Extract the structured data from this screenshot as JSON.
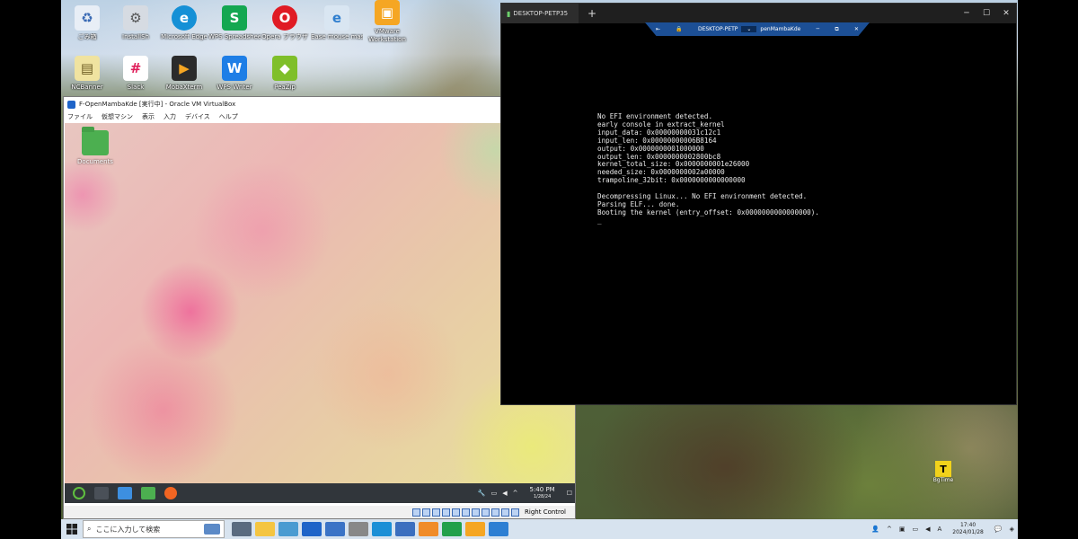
{
  "desktop": {
    "icons": [
      {
        "label": "ごみ箱",
        "icon": "recycle-bin-icon",
        "color": "#e8eef6"
      },
      {
        "label": "InstallSh",
        "icon": "installer-icon",
        "color": "#d6dbe2"
      },
      {
        "label": "Microsoft Edge",
        "icon": "edge-icon",
        "color": "#1590d6"
      },
      {
        "label": "WPS Spreadsheets",
        "icon": "wps-spreadsheets-icon",
        "color": "#14a751"
      },
      {
        "label": "Opera ブラウザ",
        "icon": "opera-icon",
        "color": "#e01b24"
      },
      {
        "label": "Ease mouse master",
        "icon": "document-icon",
        "color": "#d9e6f2"
      },
      {
        "label": "VMware Workstation",
        "icon": "vmware-icon",
        "color": "#f5a623"
      },
      {
        "label": "NCBanner",
        "icon": "notebook-icon",
        "color": "#f0e3a0"
      },
      {
        "label": "Slack",
        "icon": "slack-icon",
        "color": "#ffffff"
      },
      {
        "label": "MobaXterm",
        "icon": "mobaxterm-icon",
        "color": "#2b2b2b"
      },
      {
        "label": "WPS Writer",
        "icon": "wps-writer-icon",
        "color": "#1e7ee6"
      },
      {
        "label": "PeaZip",
        "icon": "peazip-icon",
        "color": "#7fbf2a"
      }
    ],
    "right_icon_label": "BgTime"
  },
  "vbox": {
    "title": "F-OpenMambaKde [実行中] - Oracle VM VirtualBox",
    "menu": [
      "ファイル",
      "仮想マシン",
      "表示",
      "入力",
      "デバイス",
      "ヘルプ"
    ],
    "guest": {
      "desktop_icon_label": "Documents",
      "clock_time": "5:40 PM",
      "clock_date": "1/28/24"
    },
    "status_right": "Right Control"
  },
  "rdp": {
    "tab_title": "DESKTOP-PETP35",
    "connection_bar_left": "DESKTOP-PETP",
    "connection_bar_right": "penMambaKde",
    "console_lines": [
      "No EFI environment detected.",
      "early console in extract_kernel",
      "input_data: 0x00000000031c12c1",
      "input_len: 0x00000000006B8164",
      "output: 0x0000000001000000",
      "output_len: 0x0000000002800bc8",
      "kernel_total_size: 0x0000000001e26000",
      "needed_size: 0x0000000002a00000",
      "trampoline_32bit: 0x0000000000000000",
      "",
      "Decompressing Linux... No EFI environment detected.",
      "Parsing ELF... done.",
      "Booting the kernel (entry_offset: 0x0000000000000000).",
      "_"
    ]
  },
  "taskbar": {
    "search_placeholder": "ここに入力して検索",
    "clock_time": "17:40",
    "clock_date": "2024/01/28",
    "pinned_colors": [
      "#5a6b7f",
      "#f4c542",
      "#4a9bd1",
      "#1e64c8",
      "#3a73c6",
      "#888888",
      "#1b8fd6",
      "#3b6fbf",
      "#f08c2a",
      "#22a04b",
      "#f5a623",
      "#2d7fd3"
    ]
  }
}
